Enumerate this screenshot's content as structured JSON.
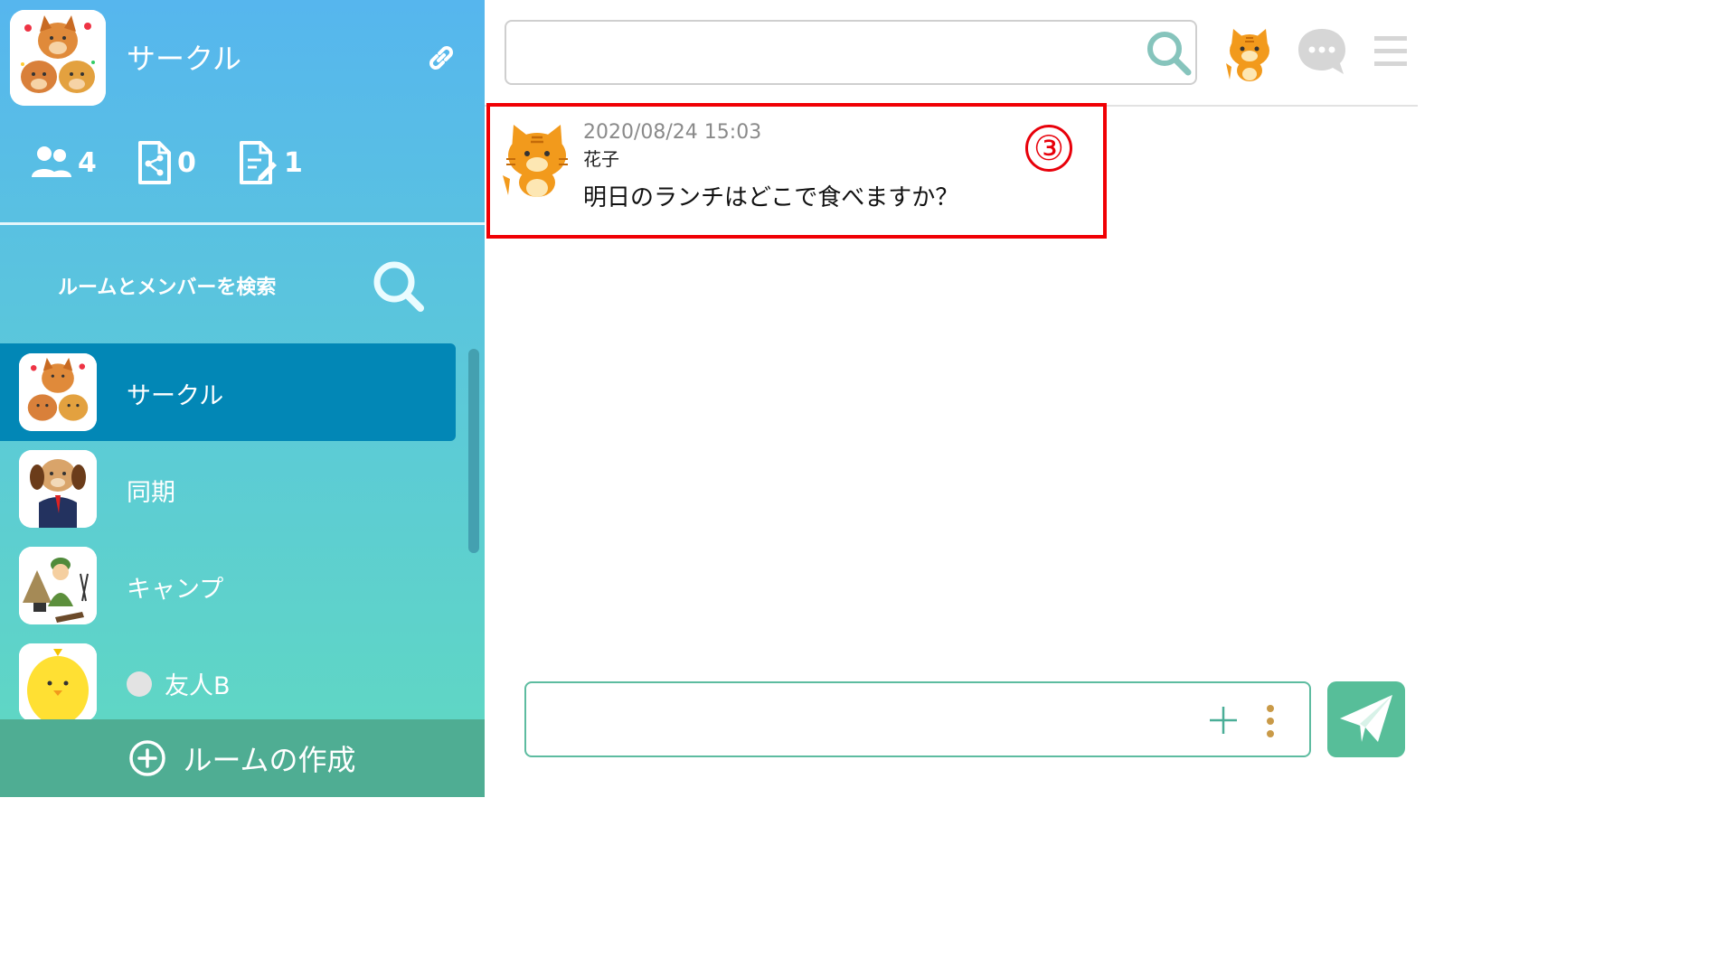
{
  "sidebar": {
    "group": {
      "name": "サークル"
    },
    "stats": {
      "members": "4",
      "files": "0",
      "notes": "1"
    },
    "search_label": "ルームとメンバーを検索",
    "rooms": [
      {
        "name": "サークル",
        "active": true
      },
      {
        "name": "同期"
      },
      {
        "name": "キャンプ"
      },
      {
        "name": "友人B",
        "status": "offline"
      }
    ],
    "create_room_label": "ルームの作成"
  },
  "header": {
    "search": {
      "value": "",
      "placeholder": ""
    }
  },
  "message": {
    "timestamp": "2020/08/24 15:03",
    "sender": "花子",
    "text": "明日のランチはどこで食べますか？",
    "annotation_marker": "③"
  },
  "composer": {
    "value": "",
    "placeholder": ""
  },
  "colors": {
    "sidebar_top": "#56b6ee",
    "sidebar_bottom": "#60d9c0",
    "active_room": "#0287b6",
    "create_room_bar": "#4fad93",
    "accent_green": "#57be99",
    "highlight_red": "#f00004"
  },
  "icons": [
    "link-icon",
    "members-icon",
    "shared-files-icon",
    "notes-icon",
    "search-icon",
    "cat-avatar-icon",
    "chat-bubble-icon",
    "hamburger-menu-icon",
    "plus-icon",
    "more-vertical-icon",
    "send-icon",
    "add-circle-icon"
  ]
}
